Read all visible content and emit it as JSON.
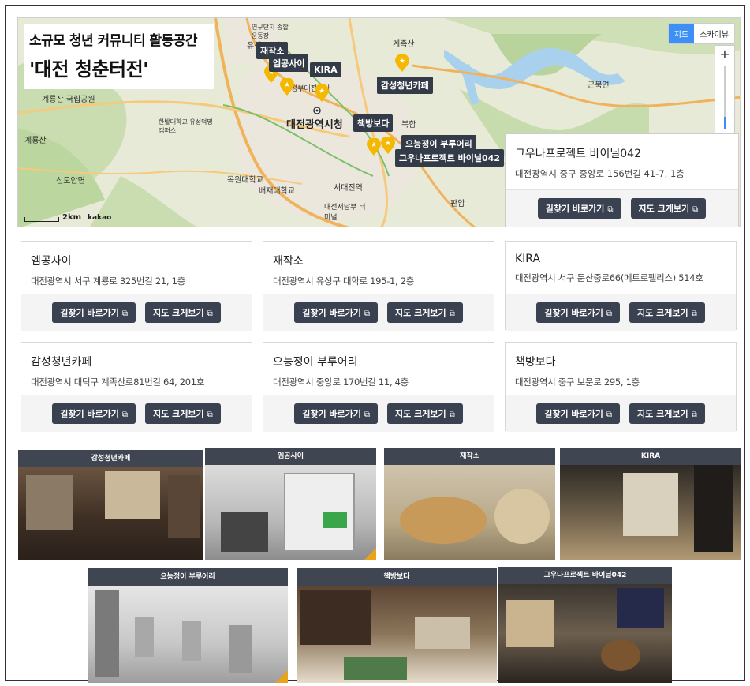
{
  "map": {
    "title_line1": "소규모 청년 커뮤니티 활동공간",
    "title_line2": "'대전 청춘터전'",
    "map_type": [
      "지도",
      "스카이뷰"
    ],
    "map_type_active": "지도",
    "zoom_plus": "+",
    "zoom_level_fraction": 0.2,
    "scale_label": "2km",
    "provider": "kakao",
    "markers": [
      "재작소",
      "엠공사이",
      "KIRA",
      "감성청년카페",
      "책방보다",
      "으능정이 부루어리",
      "그우나프로젝트 바이닐042"
    ],
    "places": [
      "계룡산 국립공원",
      "계룡산",
      "신도안면",
      "대전광역시청",
      "한밭대학교 유성덕명캠퍼스",
      "목원대학교",
      "배재대학교",
      "서대전역",
      "대전서남부 터미널",
      "계족산",
      "군북면",
      "연구단지 종합운동장",
      "유성",
      "정부대전청사",
      "복합",
      "판암"
    ],
    "popup": {
      "name": "그우나프로젝트 바이닐042",
      "addr": "대전광역시 중구 중앙로 156번길 41-7, 1층",
      "btn_route": "길찾기 바로가기",
      "btn_map": "지도 크게보기"
    }
  },
  "cards": [
    {
      "name": "엠공사이",
      "addr": "대전광역시 서구 계룡로 325번길 21, 1층",
      "btn_route": "길찾기 바로가기",
      "btn_map": "지도 크게보기"
    },
    {
      "name": "재작소",
      "addr": "대전광역시 유성구 대학로 195-1, 2층",
      "btn_route": "길찾기 바로가기",
      "btn_map": "지도 크게보기"
    },
    {
      "name": "KIRA",
      "addr": "대전광역시 서구 둔산중로66(메트로팰리스) 514호",
      "btn_route": "길찾기 바로가기",
      "btn_map": "지도 크게보기"
    },
    {
      "name": "감성청년카페",
      "addr": "대전광역시 대덕구 계족산로81번길 64, 201호",
      "btn_route": "길찾기 바로가기",
      "btn_map": "지도 크게보기"
    },
    {
      "name": "으능정이 부루어리",
      "addr": "대전광역시 중앙로 170번길 11, 4층",
      "btn_route": "길찾기 바로가기",
      "btn_map": "지도 크게보기"
    },
    {
      "name": "책방보다",
      "addr": "대전광역시 중구 보문로 295, 1층",
      "btn_route": "길찾기 바로가기",
      "btn_map": "지도 크게보기"
    }
  ],
  "photos": [
    {
      "caption": "감성청년카페"
    },
    {
      "caption": "엠공사이"
    },
    {
      "caption": "재작소"
    },
    {
      "caption": "KIRA"
    },
    {
      "caption": "으능정이 부루어리"
    },
    {
      "caption": "책방보다"
    },
    {
      "caption": "그우나프로젝트 바이닐042"
    }
  ],
  "icons": {
    "external_link": "external-link-icon",
    "star_marker": "star-marker-icon",
    "city_hall": "city-hall-icon"
  },
  "colors": {
    "button_bg": "#3a4150",
    "marker_label_bg": "#333a48",
    "star": "#f5b800",
    "accent_blue": "#3b8ff5",
    "caption_bg": "#404552"
  }
}
